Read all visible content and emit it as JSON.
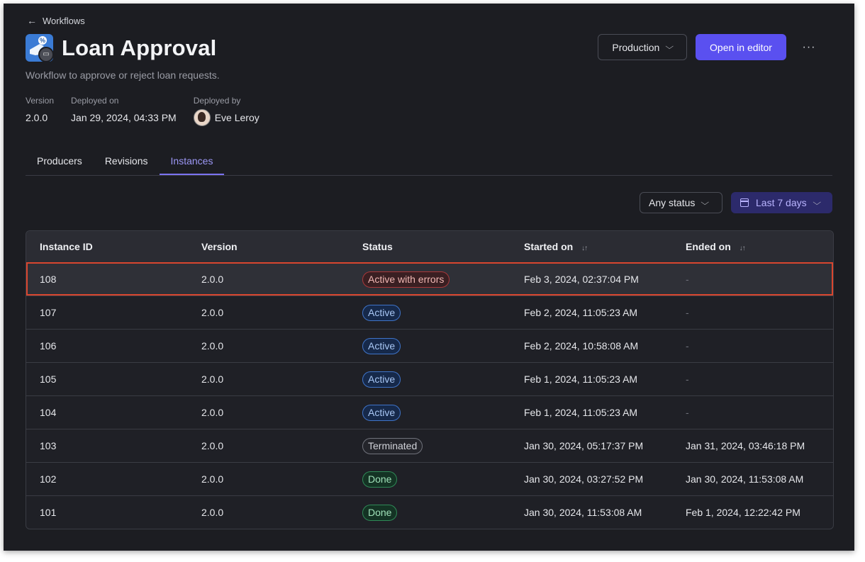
{
  "breadcrumb": {
    "back_label": "Workflows"
  },
  "header": {
    "title": "Loan Approval",
    "subtitle": "Workflow to approve or reject loan requests.",
    "environment": "Production",
    "open_editor": "Open in editor",
    "more": "···"
  },
  "meta": {
    "version_label": "Version",
    "version_value": "2.0.0",
    "deployed_on_label": "Deployed on",
    "deployed_on_value": "Jan 29, 2024, 04:33 PM",
    "deployed_by_label": "Deployed by",
    "deployed_by_value": "Eve Leroy"
  },
  "tabs": [
    {
      "label": "Producers"
    },
    {
      "label": "Revisions"
    },
    {
      "label": "Instances"
    }
  ],
  "filters": {
    "status": "Any status",
    "range": "Last 7 days"
  },
  "table": {
    "columns": [
      "Instance ID",
      "Version",
      "Status",
      "Started on",
      "Ended on"
    ],
    "sort_glyph": "↓↑",
    "rows": [
      {
        "id": "108",
        "version": "2.0.0",
        "status": "Active with errors",
        "started": "Feb 3, 2024, 02:37:04 PM",
        "ended": "-"
      },
      {
        "id": "107",
        "version": "2.0.0",
        "status": "Active",
        "started": "Feb 2, 2024, 11:05:23 AM",
        "ended": "-"
      },
      {
        "id": "106",
        "version": "2.0.0",
        "status": "Active",
        "started": "Feb 2, 2024, 10:58:08 AM",
        "ended": "-"
      },
      {
        "id": "105",
        "version": "2.0.0",
        "status": "Active",
        "started": "Feb 1, 2024, 11:05:23 AM",
        "ended": "-"
      },
      {
        "id": "104",
        "version": "2.0.0",
        "status": "Active",
        "started": "Feb 1, 2024, 11:05:23 AM",
        "ended": "-"
      },
      {
        "id": "103",
        "version": "2.0.0",
        "status": "Terminated",
        "started": "Jan 30, 2024, 05:17:37 PM",
        "ended": "Jan 31, 2024, 03:46:18 PM"
      },
      {
        "id": "102",
        "version": "2.0.0",
        "status": "Done",
        "started": "Jan 30, 2024, 03:27:52 PM",
        "ended": "Jan 30, 2024, 11:53:08 AM"
      },
      {
        "id": "101",
        "version": "2.0.0",
        "status": "Done",
        "started": "Jan 30, 2024, 11:53:08 AM",
        "ended": "Feb 1, 2024, 12:22:42 PM"
      }
    ]
  },
  "colors": {
    "accent": "#5a50f0",
    "selected_outline": "#d9462f",
    "status_error": "#a9383a",
    "status_active": "#3f74c9",
    "status_done": "#2f8a57",
    "status_terminated": "#70727b"
  }
}
